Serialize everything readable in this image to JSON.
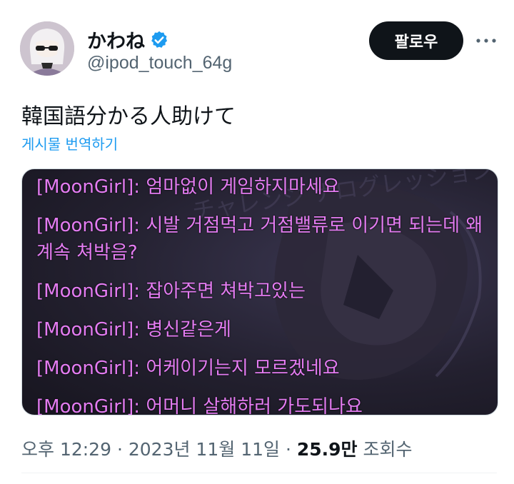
{
  "author": {
    "display_name": "かわね",
    "handle": "@ipod_touch_64g",
    "verified": true
  },
  "actions": {
    "follow_label": "팔로우",
    "more_icon": "more-horizontal-icon"
  },
  "tweet": {
    "text": "韓国語分かる人助けて",
    "translate_label": "게시물 번역하기"
  },
  "media": {
    "chat_lines": [
      "[MoonGirl]: 엄마없이 게임하지마세요",
      "[MoonGirl]: 시발 거점먹고 거점밸류로 이기면 되는데 왜 계속 쳐박음?",
      "[MoonGirl]: 잡아주면 쳐박고있는",
      "[MoonGirl]: 병신같은게",
      "[MoonGirl]: 어케이기는지 모르겠네요",
      "[MoonGirl]: 어머니 살해하러 가도되나요"
    ],
    "background_text": "チャレンジ ナログレッション"
  },
  "meta": {
    "time": "오후 12:29",
    "separator": "·",
    "date": "2023년 11월 11일",
    "views_count": "25.9만",
    "views_label": "조회수"
  },
  "colors": {
    "text_primary": "#0f1419",
    "text_secondary": "#536471",
    "link": "#1d9bf0",
    "chat_text": "#e47cf2",
    "follow_bg": "#0f1419"
  }
}
